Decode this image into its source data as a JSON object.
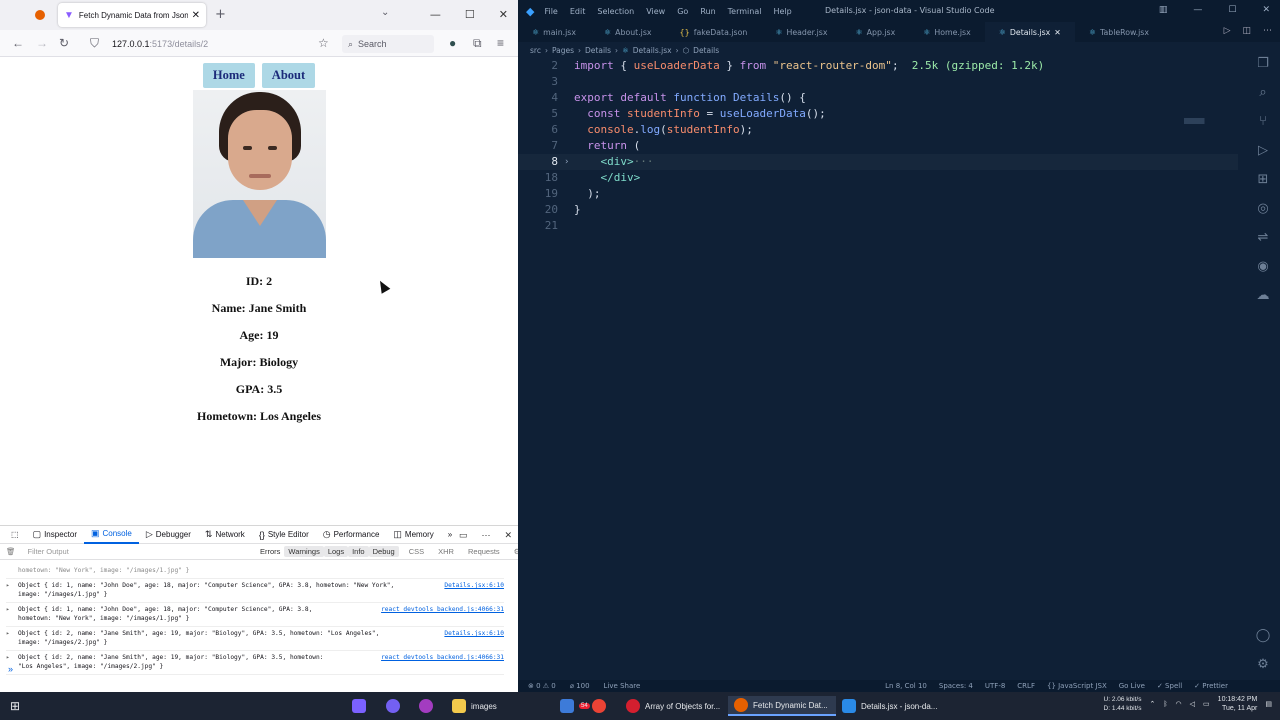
{
  "firefox": {
    "tab_title": "Fetch Dynamic Data from Json",
    "url_host": "127.0.0.1",
    "url_path": ":5173/details/2",
    "search_placeholder": "Search"
  },
  "page": {
    "nav": {
      "home": "Home",
      "about": "About"
    },
    "info": {
      "id": "ID: 2",
      "name": "Name: Jane Smith",
      "age": "Age: 19",
      "major": "Major: Biology",
      "gpa": "GPA: 3.5",
      "hometown": "Hometown: Los Angeles"
    }
  },
  "devtools": {
    "tabs": [
      "Inspector",
      "Console",
      "Debugger",
      "Network",
      "Style Editor",
      "Performance",
      "Memory"
    ],
    "filter_placeholder": "Filter Output",
    "levels": [
      "Errors",
      "Warnings",
      "Logs",
      "Info",
      "Debug"
    ],
    "extra_filters": [
      "CSS",
      "XHR",
      "Requests"
    ],
    "log_top": "hometown: \"New York\", image: \"/images/1.jpg\" }",
    "logs": [
      {
        "line1": "Object { id: 1, name: \"John Doe\", age: 18, major: \"Computer Science\", GPA: 3.8, hometown: \"New York\",",
        "line2": "image: \"/images/1.jpg\" }",
        "source": "Details.jsx:6:10"
      },
      {
        "line1": "Object { id: 1, name: \"John Doe\", age: 18, major: \"Computer Science\", GPA: 3.8,",
        "line2": "hometown: \"New York\", image: \"/images/1.jpg\" }",
        "source": "react_devtools_backend.js:4066:31"
      },
      {
        "line1": "Object { id: 2, name: \"Jane Smith\", age: 19, major: \"Biology\", GPA: 3.5, hometown: \"Los Angeles\",",
        "line2": "image: \"/images/2.jpg\" }",
        "source": "Details.jsx:6:10"
      },
      {
        "line1": "Object { id: 2, name: \"Jane Smith\", age: 19, major: \"Biology\", GPA: 3.5, hometown:",
        "line2": "\"Los Angeles\", image: \"/images/2.jpg\" }",
        "source": "react_devtools_backend.js:4066:31"
      }
    ]
  },
  "vscode": {
    "menu": [
      "File",
      "Edit",
      "Selection",
      "View",
      "Go",
      "Run",
      "Terminal",
      "Help"
    ],
    "window_title": "Details.jsx - json-data - Visual Studio Code",
    "tabs": [
      {
        "label": "main.jsx",
        "icon": "react-icon"
      },
      {
        "label": "About.jsx",
        "icon": "react-icon"
      },
      {
        "label": "fakeData.json",
        "icon": "json-icon"
      },
      {
        "label": "Header.jsx",
        "icon": "react-icon"
      },
      {
        "label": "App.jsx",
        "icon": "react-icon"
      },
      {
        "label": "Home.jsx",
        "icon": "react-icon"
      },
      {
        "label": "Details.jsx",
        "icon": "react-icon",
        "active": true
      },
      {
        "label": "TableRow.jsx",
        "icon": "react-icon"
      }
    ],
    "breadcrumb": [
      "src",
      "Pages",
      "Details",
      "Details.jsx",
      "Details"
    ],
    "code": {
      "l2": {
        "num": "2",
        "kw": "import",
        "p1": " { ",
        "fn": "useLoaderData",
        "p2": " } ",
        "from": "from",
        "str": " \"react-router-dom\"",
        "semi": ";",
        "hint": "  2.5k (gzipped: 1.2k)"
      },
      "l3": {
        "num": "3"
      },
      "l4": {
        "num": "4",
        "kw1": "export",
        "kw2": " default",
        "kw3": " function",
        "fn": " Details",
        "rest": "() {"
      },
      "l5": {
        "num": "5",
        "kw": "const",
        "var": " studentInfo",
        "eq": " = ",
        "fn": "useLoaderData",
        "rest": "();"
      },
      "l6": {
        "num": "6",
        "obj": "console",
        "dot": ".",
        "fn": "log",
        "open": "(",
        "var": "studentInfo",
        "close": ");"
      },
      "l7": {
        "num": "7",
        "kw": "return",
        "rest": " ("
      },
      "l8": {
        "num": "8",
        "tag": "<div>",
        "ell": "···"
      },
      "l18": {
        "num": "18",
        "tag": "</div>"
      },
      "l19": {
        "num": "19",
        "rest": ");"
      },
      "l20": {
        "num": "20",
        "rest": "}"
      },
      "l21": {
        "num": "21"
      }
    },
    "status": {
      "errors": "⊗ 0 ⚠ 0",
      "ports": "⌀ 100",
      "live": "Live Share",
      "position": "Ln 8, Col 10",
      "spaces": "Spaces: 4",
      "encoding": "UTF-8",
      "eol": "CRLF",
      "language": "{} JavaScript JSX",
      "golive": "Go Live",
      "spell": "✓ Spell",
      "prettier": "✓ Prettier"
    }
  },
  "taskbar": {
    "items": [
      {
        "label": "images",
        "icon": "folder-icon"
      },
      {
        "label": "Array of Objects for...",
        "icon": "opera-icon"
      },
      {
        "label": "Fetch Dynamic Dat...",
        "icon": "firefox-icon"
      },
      {
        "label": "Details.jsx - json-da...",
        "icon": "vscode-icon"
      }
    ],
    "net_up": "2.06 kbit/s",
    "net_down": "1.44 kbit/s",
    "net_u": "U:",
    "net_d": "D:",
    "time": "10:18:42 PM",
    "date": "Tue, 11 Apr",
    "badge": "54"
  }
}
